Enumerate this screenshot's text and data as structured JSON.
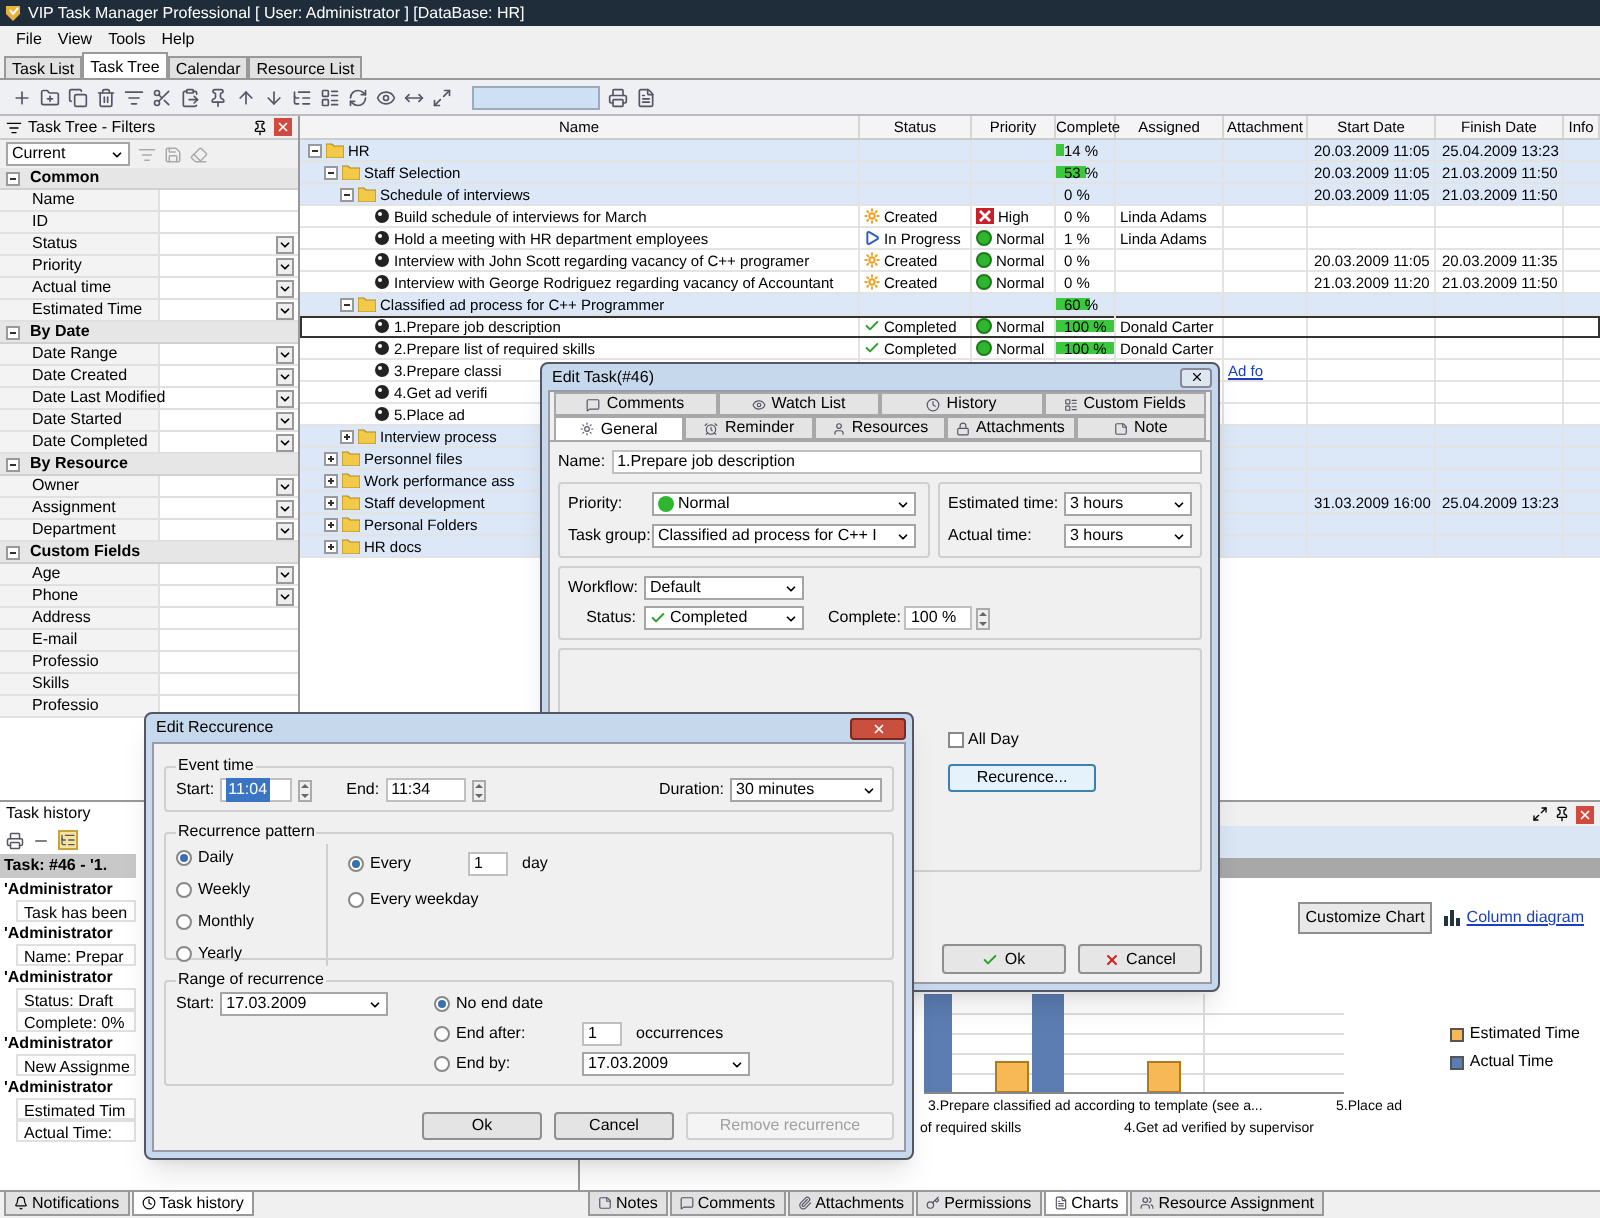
{
  "window": {
    "title": "VIP Task Manager Professional [ User: Administrator ] [DataBase: HR]"
  },
  "menu": [
    "File",
    "View",
    "Tools",
    "Help"
  ],
  "tabs": [
    {
      "label": "Task List",
      "selected": false
    },
    {
      "label": "Task Tree",
      "selected": true
    },
    {
      "label": "Calendar",
      "selected": false
    },
    {
      "label": "Resource List",
      "selected": false
    }
  ],
  "filters": {
    "title": "Task Tree - Filters",
    "preset": "Current",
    "groups": [
      {
        "label": "Common",
        "expanded": true,
        "fields": [
          {
            "label": "Name",
            "dropdown": false
          },
          {
            "label": "ID",
            "dropdown": false
          },
          {
            "label": "Status",
            "dropdown": true
          },
          {
            "label": "Priority",
            "dropdown": true
          },
          {
            "label": "Actual time",
            "dropdown": true
          },
          {
            "label": "Estimated Time",
            "dropdown": true
          }
        ]
      },
      {
        "label": "By Date",
        "expanded": true,
        "fields": [
          {
            "label": "Date Range",
            "dropdown": true
          },
          {
            "label": "Date Created",
            "dropdown": true
          },
          {
            "label": "Date Last Modified",
            "dropdown": true
          },
          {
            "label": "Date Started",
            "dropdown": true
          },
          {
            "label": "Date Completed",
            "dropdown": true
          }
        ]
      },
      {
        "label": "By Resource",
        "expanded": true,
        "fields": [
          {
            "label": "Owner",
            "dropdown": true
          },
          {
            "label": "Assignment",
            "dropdown": true
          },
          {
            "label": "Department",
            "dropdown": true
          }
        ]
      },
      {
        "label": "Custom Fields",
        "expanded": true,
        "fields": [
          {
            "label": "Age",
            "dropdown": true
          },
          {
            "label": "Phone",
            "dropdown": true
          },
          {
            "label": "Address",
            "dropdown": false
          },
          {
            "label": "E-mail",
            "dropdown": false
          },
          {
            "label": "Professio",
            "dropdown": false
          },
          {
            "label": "Skills",
            "dropdown": false
          },
          {
            "label": "Professio",
            "dropdown": false
          }
        ]
      }
    ]
  },
  "grid": {
    "columns": [
      "Name",
      "Status",
      "Priority",
      "Complete",
      "Assigned",
      "Attachment",
      "Start Date",
      "Finish Date",
      "Info"
    ],
    "rows": [
      {
        "name": "HR",
        "kind": "group",
        "expanded": true,
        "complete": "14 %",
        "level": 0.14,
        "start": "20.03.2009 11:05",
        "finish": "25.04.2009 13:23",
        "children": [
          {
            "name": "Staff Selection",
            "kind": "group",
            "expanded": true,
            "complete": "53 %",
            "level": 0.53,
            "start": "20.03.2009 11:05",
            "finish": "21.03.2009 11:50",
            "children": [
              {
                "name": "Schedule of interviews",
                "kind": "group",
                "expanded": true,
                "complete": "0 %",
                "start": "20.03.2009 11:05",
                "finish": "21.03.2009 11:50",
                "children": [
                  {
                    "name": "Build schedule of interviews for March",
                    "kind": "task",
                    "status": {
                      "label": "Created",
                      "kind": "created"
                    },
                    "priority": {
                      "label": "High",
                      "kind": "high"
                    },
                    "complete": "0 %",
                    "assigned": "Linda Adams"
                  },
                  {
                    "name": "Hold a meeting with HR department employees",
                    "kind": "task",
                    "status": {
                      "label": "In Progress",
                      "kind": "in_progress"
                    },
                    "priority": {
                      "label": "Normal",
                      "kind": "normal"
                    },
                    "complete": "1 %",
                    "assigned": "Linda Adams"
                  },
                  {
                    "name": "Interview with John Scott regarding vacancy of C++ programer",
                    "kind": "task",
                    "status": {
                      "label": "Created",
                      "kind": "created"
                    },
                    "priority": {
                      "label": "Normal",
                      "kind": "normal"
                    },
                    "complete": "0 %",
                    "start": "20.03.2009 11:05",
                    "finish": "20.03.2009 11:35"
                  },
                  {
                    "name": "Interview with George Rodriguez regarding vacancy of Accountant",
                    "kind": "task",
                    "status": {
                      "label": "Created",
                      "kind": "created"
                    },
                    "priority": {
                      "label": "Normal",
                      "kind": "normal"
                    },
                    "complete": "0 %",
                    "start": "21.03.2009 11:20",
                    "finish": "21.03.2009 11:50"
                  }
                ]
              },
              {
                "name": "Classified ad process for C++ Programmer",
                "kind": "group",
                "expanded": true,
                "complete": "60 %",
                "level": 0.6,
                "children": [
                  {
                    "name": "1.Prepare job description",
                    "kind": "task",
                    "focused": true,
                    "status": {
                      "label": "Completed",
                      "kind": "completed"
                    },
                    "priority": {
                      "label": "Normal",
                      "kind": "normal"
                    },
                    "complete": "100 %",
                    "level": 1,
                    "assigned": "Donald Carter"
                  },
                  {
                    "name": "2.Prepare list of required skills",
                    "kind": "task",
                    "focused": false,
                    "status": {
                      "label": "Completed",
                      "kind": "completed"
                    },
                    "priority": {
                      "label": "Normal",
                      "kind": "normal"
                    },
                    "complete": "100 %",
                    "level": 1,
                    "assigned": "Donald Carter"
                  },
                  {
                    "name": "3.Prepare classi",
                    "kind": "task",
                    "attachment": "Ad fo"
                  },
                  {
                    "name": "4.Get ad verifi",
                    "kind": "task"
                  },
                  {
                    "name": "5.Place ad",
                    "kind": "task"
                  }
                ]
              },
              {
                "name": "Interview process",
                "kind": "group",
                "expanded": false
              }
            ]
          },
          {
            "name": "Personnel files",
            "kind": "group",
            "expanded": false
          },
          {
            "name": "Work performance ass",
            "kind": "group",
            "expanded": false
          },
          {
            "name": "Staff development",
            "kind": "group",
            "expanded": false,
            "start": "31.03.2009 16:00",
            "finish": "25.04.2009 13:23"
          },
          {
            "name": "Personal Folders",
            "kind": "group",
            "expanded": false
          },
          {
            "name": "HR docs",
            "kind": "group",
            "expanded": false
          }
        ]
      }
    ]
  },
  "task_history": {
    "title": "Task history",
    "task": "Task: #46 - '1.",
    "entries": [
      {
        "user": "'Administrator",
        "details": [
          "Task has been"
        ]
      },
      {
        "user": "'Administrator",
        "details": [
          "Name: Prepar"
        ]
      },
      {
        "user": "'Administrator",
        "details": [
          "Status: Draft",
          "Complete: 0%"
        ]
      },
      {
        "user": "'Administrator",
        "details": [
          "New Assignme"
        ]
      },
      {
        "user": "'Administrator",
        "details": [
          "Estimated Tim",
          "Actual Time:"
        ]
      }
    ]
  },
  "chart_panel": {
    "customize": "Customize Chart",
    "chart_type": "Column diagram",
    "legend": [
      {
        "label": "Estimated Time",
        "color": "#f7b955"
      },
      {
        "label": "Actual Time",
        "color": "#5b7db1"
      }
    ],
    "x_labels": [
      "3.Prepare classified ad according to template (see a...",
      "5.Place ad",
      "of required skills",
      "4.Get ad verified by supervisor"
    ]
  },
  "bottom_tabs_left": [
    {
      "label": "Notifications",
      "selected": false
    },
    {
      "label": "Task history",
      "selected": true
    }
  ],
  "bottom_tabs_right": [
    {
      "label": "Notes",
      "selected": false
    },
    {
      "label": "Comments",
      "selected": false
    },
    {
      "label": "Attachments",
      "selected": false
    },
    {
      "label": "Permissions",
      "selected": false
    },
    {
      "label": "Charts",
      "selected": true
    },
    {
      "label": "Resource Assignment",
      "selected": false
    }
  ],
  "edit_task": {
    "title": "Edit Task(#46)",
    "tab_rows": [
      [
        {
          "label": "Comments",
          "selected": false
        },
        {
          "label": "Watch List",
          "selected": false
        },
        {
          "label": "History",
          "selected": false
        },
        {
          "label": "Custom Fields",
          "selected": false
        }
      ],
      [
        {
          "label": "General",
          "selected": true
        },
        {
          "label": "Reminder",
          "selected": false
        },
        {
          "label": "Resources",
          "selected": false
        },
        {
          "label": "Attachments",
          "selected": false
        },
        {
          "label": "Note",
          "selected": false
        }
      ]
    ],
    "name_label": "Name:",
    "name": "1.Prepare job description",
    "priority_label": "Priority:",
    "priority": "Normal",
    "task_group_label": "Task group:",
    "task_group": "Classified ad process for C++ I",
    "estimated_label": "Estimated time:",
    "estimated": "3 hours",
    "actual_label": "Actual time:",
    "actual": "3 hours",
    "workflow_label": "Workflow:",
    "workflow": "Default",
    "status_label": "Status:",
    "status": "Completed",
    "complete_label": "Complete:",
    "complete": "100 %",
    "all_day": {
      "label": "All Day",
      "checked": false
    },
    "recurrence_button": "Recurence...",
    "buttons": [
      {
        "label": "Ok",
        "kind": "ok"
      },
      {
        "label": "Cancel",
        "kind": "cancel"
      }
    ]
  },
  "edit_recurrence": {
    "title": "Edit Reccurence",
    "event_time": {
      "label": "Event time",
      "start_label": "Start:",
      "start": "11:04",
      "end_label": "End:",
      "end": "11:34",
      "duration_label": "Duration:",
      "duration": "30 minutes"
    },
    "pattern": {
      "label": "Recurrence pattern",
      "types": [
        {
          "label": "Daily",
          "selected": true
        },
        {
          "label": "Weekly",
          "selected": false
        },
        {
          "label": "Monthly",
          "selected": false
        },
        {
          "label": "Yearly",
          "selected": false
        }
      ],
      "options": [
        {
          "label": "Every",
          "selected": true,
          "value": "1",
          "unit": "day"
        },
        {
          "label": "Every weekday",
          "selected": false
        }
      ]
    },
    "range": {
      "label": "Range of recurrence",
      "start_label": "Start:",
      "start": "17.03.2009",
      "ends": [
        {
          "label": "No end date",
          "selected": true
        },
        {
          "label": "End after:",
          "selected": false,
          "value": "1",
          "unit": "occurrences"
        },
        {
          "label": "End by:",
          "selected": false,
          "date": "17.03.2009"
        }
      ]
    },
    "buttons": [
      {
        "label": "Ok",
        "disabled": false
      },
      {
        "label": "Cancel",
        "disabled": false
      },
      {
        "label": "Remove recurrence",
        "disabled": true
      }
    ]
  }
}
